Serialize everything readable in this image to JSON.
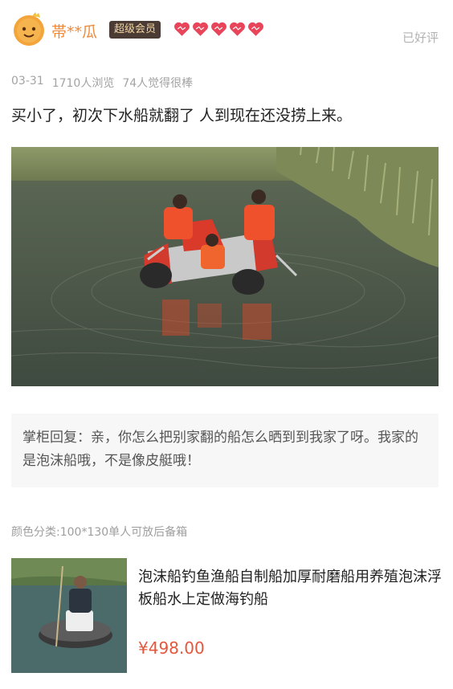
{
  "user": {
    "name": "帯**瓜",
    "badge": "超级会员",
    "hearts": 5,
    "praise_tag": "已好评"
  },
  "review": {
    "date": "03-31",
    "views": "1710人浏览",
    "likes": "74人觉得很棒",
    "text": "买小了，初次下水船就翻了 人到现在还没捞上来。"
  },
  "reply": {
    "text": "掌柜回复：亲，你怎么把别家翻的船怎么晒到到我家了呀。我家的是泡沫船哦，不是像皮艇哦！"
  },
  "sku": {
    "text": "颜色分类:100*130单人可放后备箱"
  },
  "product": {
    "title": "泡沫船钓鱼渔船自制船加厚耐磨船用养殖泡沫浮板船水上定做海钓船",
    "price": "¥498.00"
  },
  "colors": {
    "accent": "#f08a3a",
    "price": "#e4573d",
    "heart": "#e8455a"
  }
}
